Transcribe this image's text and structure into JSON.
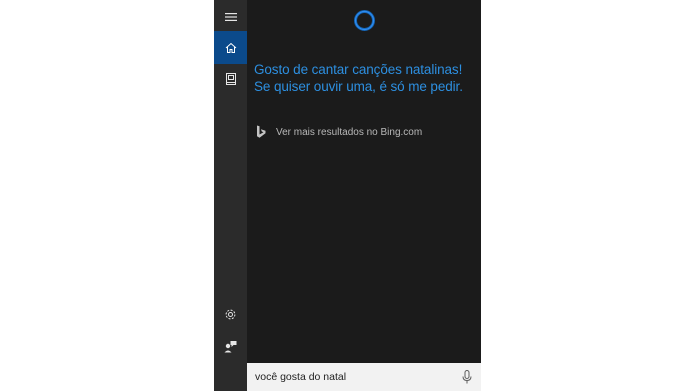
{
  "cortana": {
    "response_lines": [
      "Gosto de cantar canções natalinas!",
      "Se quiser ouvir uma, é só me pedir."
    ],
    "bing_link": "Ver mais resultados no Bing.com"
  },
  "search": {
    "query": "você gosta do natal"
  },
  "icons": {
    "menu": "hamburger-menu-icon",
    "home": "home-icon",
    "notebook": "notebook-icon",
    "settings": "gear-icon",
    "feedback": "feedback-icon",
    "cortana": "cortana-ring-icon",
    "bing": "bing-logo-icon",
    "mic": "microphone-icon"
  },
  "colors": {
    "panel_bg": "#1b1b1b",
    "rail_bg": "#2b2b2b",
    "active_accent": "#0b4a8b",
    "response_text": "#2d8fe0",
    "search_bg": "#f2f2f2"
  }
}
